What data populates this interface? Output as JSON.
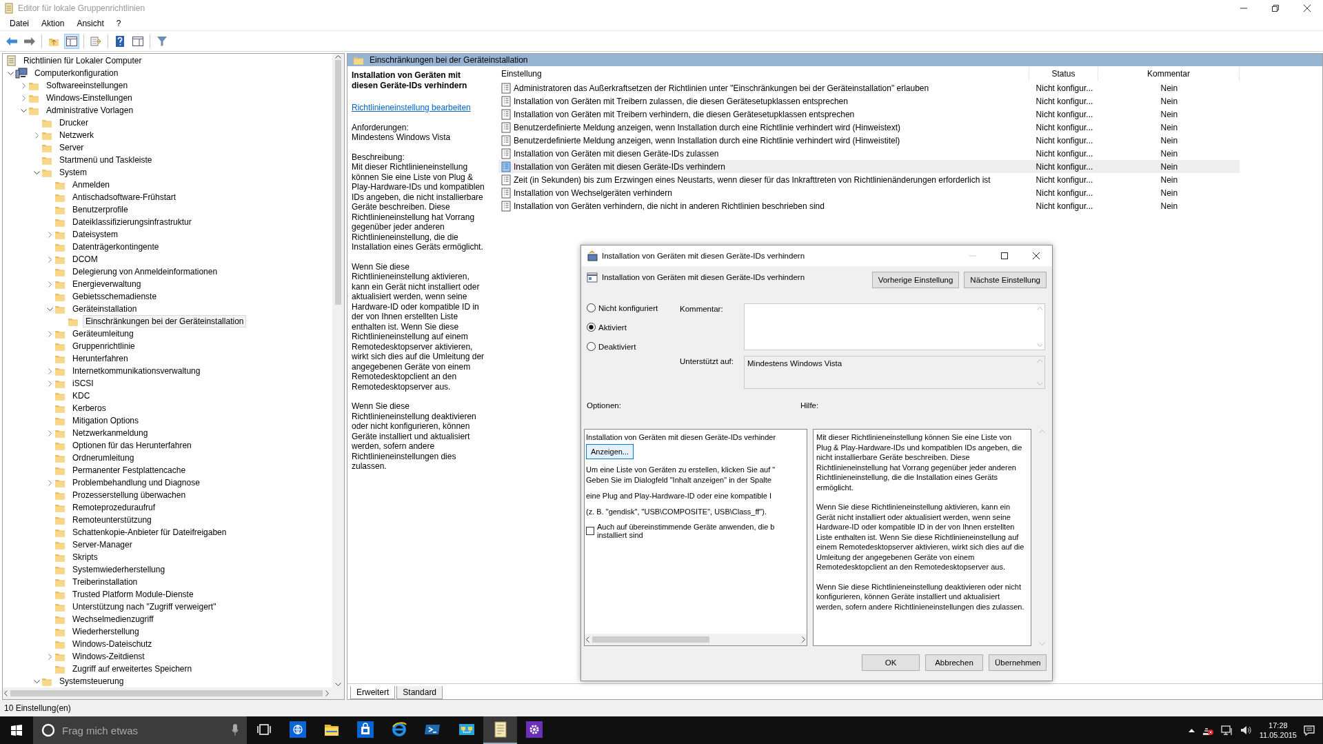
{
  "window": {
    "title": "Editor für lokale Gruppenrichtlinien"
  },
  "menu": [
    "Datei",
    "Aktion",
    "Ansicht",
    "?"
  ],
  "toolbar": {
    "show_tree_pressed": true
  },
  "tree": {
    "items": [
      {
        "label": "Richtlinien für Lokaler Computer",
        "kind": "root",
        "selected": false,
        "children": [
          {
            "label": "Computerkonfiguration",
            "kind": "computer",
            "expanded": true,
            "selected": false,
            "children": [
              {
                "label": "Softwareeinstellungen",
                "kind": "folder",
                "expanded": false,
                "selected": false
              },
              {
                "label": "Windows-Einstellungen",
                "kind": "folder",
                "expanded": false,
                "selected": false
              },
              {
                "label": "Administrative Vorlagen",
                "kind": "folder",
                "expanded": true,
                "selected": false,
                "children": [
                  {
                    "label": "Drucker",
                    "kind": "folder",
                    "selected": false
                  },
                  {
                    "label": "Netzwerk",
                    "kind": "folder",
                    "expanded": false,
                    "selected": false
                  },
                  {
                    "label": "Server",
                    "kind": "folder",
                    "selected": false
                  },
                  {
                    "label": "Startmenü und Taskleiste",
                    "kind": "folder",
                    "selected": false
                  },
                  {
                    "label": "System",
                    "kind": "folder",
                    "expanded": true,
                    "selected": false,
                    "children": [
                      {
                        "label": "Anmelden",
                        "kind": "folder",
                        "selected": false
                      },
                      {
                        "label": "Antischadsoftware-Frühstart",
                        "kind": "folder",
                        "selected": false
                      },
                      {
                        "label": "Benutzerprofile",
                        "kind": "folder",
                        "selected": false
                      },
                      {
                        "label": "Dateiklassifizierungsinfrastruktur",
                        "kind": "folder",
                        "selected": false
                      },
                      {
                        "label": "Dateisystem",
                        "kind": "folder",
                        "expanded": false,
                        "selected": false
                      },
                      {
                        "label": "Datenträgerkontingente",
                        "kind": "folder",
                        "selected": false
                      },
                      {
                        "label": "DCOM",
                        "kind": "folder",
                        "expanded": false,
                        "selected": false
                      },
                      {
                        "label": "Delegierung von Anmeldeinformationen",
                        "kind": "folder",
                        "selected": false
                      },
                      {
                        "label": "Energieverwaltung",
                        "kind": "folder",
                        "expanded": false,
                        "selected": false
                      },
                      {
                        "label": "Gebietsschemadienste",
                        "kind": "folder",
                        "selected": false
                      },
                      {
                        "label": "Geräteinstallation",
                        "kind": "folder",
                        "expanded": true,
                        "selected": false,
                        "children": [
                          {
                            "label": "Einschränkungen bei der Geräteinstallation",
                            "kind": "folder",
                            "selected": true
                          }
                        ]
                      },
                      {
                        "label": "Geräteumleitung",
                        "kind": "folder",
                        "expanded": false,
                        "selected": false
                      },
                      {
                        "label": "Gruppenrichtlinie",
                        "kind": "folder",
                        "selected": false
                      },
                      {
                        "label": "Herunterfahren",
                        "kind": "folder",
                        "selected": false
                      },
                      {
                        "label": "Internetkommunikationsverwaltung",
                        "kind": "folder",
                        "expanded": false,
                        "selected": false
                      },
                      {
                        "label": "iSCSI",
                        "kind": "folder",
                        "expanded": false,
                        "selected": false
                      },
                      {
                        "label": "KDC",
                        "kind": "folder",
                        "selected": false
                      },
                      {
                        "label": "Kerberos",
                        "kind": "folder",
                        "selected": false
                      },
                      {
                        "label": "Mitigation Options",
                        "kind": "folder",
                        "selected": false
                      },
                      {
                        "label": "Netzwerkanmeldung",
                        "kind": "folder",
                        "expanded": false,
                        "selected": false
                      },
                      {
                        "label": "Optionen für das Herunterfahren",
                        "kind": "folder",
                        "selected": false
                      },
                      {
                        "label": "Ordnerumleitung",
                        "kind": "folder",
                        "selected": false
                      },
                      {
                        "label": "Permanenter Festplattencache",
                        "kind": "folder",
                        "selected": false
                      },
                      {
                        "label": "Problembehandlung und Diagnose",
                        "kind": "folder",
                        "expanded": false,
                        "selected": false
                      },
                      {
                        "label": "Prozesserstellung überwachen",
                        "kind": "folder",
                        "selected": false
                      },
                      {
                        "label": "Remoteprozeduraufruf",
                        "kind": "folder",
                        "selected": false
                      },
                      {
                        "label": "Remoteunterstützung",
                        "kind": "folder",
                        "selected": false
                      },
                      {
                        "label": "Schattenkopie-Anbieter für Dateifreigaben",
                        "kind": "folder",
                        "selected": false
                      },
                      {
                        "label": "Server-Manager",
                        "kind": "folder",
                        "selected": false
                      },
                      {
                        "label": "Skripts",
                        "kind": "folder",
                        "selected": false
                      },
                      {
                        "label": "Systemwiederherstellung",
                        "kind": "folder",
                        "selected": false
                      },
                      {
                        "label": "Treiberinstallation",
                        "kind": "folder",
                        "selected": false
                      },
                      {
                        "label": "Trusted Platform Module-Dienste",
                        "kind": "folder",
                        "selected": false
                      },
                      {
                        "label": "Unterstützung nach \"Zugriff verweigert\"",
                        "kind": "folder",
                        "selected": false
                      },
                      {
                        "label": "Wechselmedienzugriff",
                        "kind": "folder",
                        "selected": false
                      },
                      {
                        "label": "Wiederherstellung",
                        "kind": "folder",
                        "selected": false
                      },
                      {
                        "label": "Windows-Dateischutz",
                        "kind": "folder",
                        "selected": false
                      },
                      {
                        "label": "Windows-Zeitdienst",
                        "kind": "folder",
                        "expanded": false,
                        "selected": false
                      },
                      {
                        "label": "Zugriff auf erweitertes Speichern",
                        "kind": "folder",
                        "selected": false
                      }
                    ]
                  },
                  {
                    "label": "Systemsteuerung",
                    "kind": "folder",
                    "expanded": true,
                    "selected": false
                  }
                ]
              }
            ]
          }
        ]
      }
    ]
  },
  "details": {
    "header": "Einschränkungen bei der Geräteinstallation",
    "description": {
      "title": "Installation von Geräten mit diesen Geräte-IDs verhindern",
      "link": "Richtlinieneinstellung bearbeiten",
      "requirements_label": "Anforderungen:",
      "requirements": "Mindestens Windows Vista",
      "description_label": "Beschreibung:",
      "paragraphs": [
        "Mit dieser Richtlinieneinstellung können Sie eine Liste von Plug & Play-Hardware-IDs und kompatiblen IDs angeben, die nicht installierbare Geräte beschreiben. Diese Richtlinieneinstellung hat Vorrang gegenüber jeder anderen Richtlinieneinstellung, die die Installation eines Geräts ermöglicht.",
        "Wenn Sie diese Richtlinieneinstellung aktivieren, kann ein Gerät nicht installiert oder aktualisiert werden, wenn seine Hardware-ID oder kompatible ID in der von Ihnen erstellten Liste enthalten ist. Wenn Sie diese Richtlinieneinstellung auf einem Remotedesktopserver aktivieren, wirkt sich dies auf die Umleitung der angegebenen Geräte von einem Remotedesktopclient an den Remotedesktopserver aus.",
        "Wenn Sie diese Richtlinieneinstellung deaktivieren oder nicht konfigurieren, können Geräte installiert und aktualisiert werden, sofern andere Richtlinieneinstellungen dies zulassen."
      ]
    },
    "table": {
      "columns": [
        "Einstellung",
        "Status",
        "Kommentar"
      ],
      "rows": [
        {
          "setting": "Administratoren das Außerkraftsetzen der Richtlinien unter \"Einschränkungen bei der Geräteinstallation\" erlauben",
          "status": "Nicht konfigur...",
          "comment": "Nein",
          "selected": false
        },
        {
          "setting": "Installation von Geräten mit Treibern zulassen, die diesen Gerätesetupklassen entsprechen",
          "status": "Nicht konfigur...",
          "comment": "Nein",
          "selected": false
        },
        {
          "setting": "Installation von Geräten mit Treibern verhindern, die diesen Gerätesetupklassen entsprechen",
          "status": "Nicht konfigur...",
          "comment": "Nein",
          "selected": false
        },
        {
          "setting": "Benutzerdefinierte Meldung anzeigen, wenn Installation durch eine Richtlinie verhindert wird (Hinweistext)",
          "status": "Nicht konfigur...",
          "comment": "Nein",
          "selected": false
        },
        {
          "setting": "Benutzerdefinierte Meldung anzeigen, wenn Installation durch eine Richtlinie verhindert wird (Hinweistitel)",
          "status": "Nicht konfigur...",
          "comment": "Nein",
          "selected": false
        },
        {
          "setting": "Installation von Geräten mit diesen Geräte-IDs zulassen",
          "status": "Nicht konfigur...",
          "comment": "Nein",
          "selected": false
        },
        {
          "setting": "Installation von Geräten mit diesen Geräte-IDs verhindern",
          "status": "Nicht konfigur...",
          "comment": "Nein",
          "selected": true
        },
        {
          "setting": "Zeit (in Sekunden) bis zum Erzwingen eines Neustarts, wenn dieser für das Inkrafttreten von Richtlinienänderungen  erforderlich ist",
          "status": "Nicht konfigur...",
          "comment": "Nein",
          "selected": false
        },
        {
          "setting": "Installation von Wechselgeräten verhindern",
          "status": "Nicht konfigur...",
          "comment": "Nein",
          "selected": false
        },
        {
          "setting": "Installation von Geräten verhindern, die nicht in anderen Richtlinien beschrieben sind",
          "status": "Nicht konfigur...",
          "comment": "Nein",
          "selected": false
        }
      ]
    },
    "tabs": [
      {
        "label": "Erweitert",
        "selected": true
      },
      {
        "label": "Standard",
        "selected": false
      }
    ]
  },
  "status_bar": "10 Einstellung(en)",
  "dialog": {
    "title": "Installation von Geräten mit diesen Geräte-IDs verhindern",
    "header": "Installation von Geräten mit diesen Geräte-IDs verhindern",
    "nav_buttons": [
      "Vorherige Einstellung",
      "Nächste Einstellung"
    ],
    "states": [
      {
        "label": "Nicht konfiguriert",
        "selected": false
      },
      {
        "label": "Aktiviert",
        "selected": true
      },
      {
        "label": "Deaktiviert",
        "selected": false
      }
    ],
    "comment_label": "Kommentar:",
    "supported_label": "Unterstützt auf:",
    "supported": "Mindestens Windows Vista",
    "options_label": "Optionen:",
    "help_label": "Hilfe:",
    "options": {
      "text": "Installation von Geräten mit diesen Geräte-IDs verhinder",
      "button": "Anzeigen...",
      "notes": [
        [
          "Um eine Liste von Geräten zu erstellen, klicken Sie auf \"",
          "Geben Sie im Dialogfeld \"Inhalt anzeigen\" in der Spalte"
        ],
        [
          "eine Plug and Play-Hardware-ID oder eine kompatible I"
        ],
        [
          "(z. B. \"gendisk\", \"USB\\COMPOSITE\", USB\\Class_ff\")."
        ]
      ],
      "checkbox": {
        "lines": [
          "Auch auf übereinstimmende Geräte anwenden, die b",
          "installiert sind"
        ],
        "checked": false
      }
    },
    "help": [
      "Mit dieser Richtlinieneinstellung können Sie eine Liste von Plug & Play-Hardware-IDs und kompatiblen IDs angeben, die nicht installierbare Geräte beschreiben. Diese Richtlinieneinstellung hat Vorrang gegenüber jeder anderen Richtlinieneinstellung, die die Installation eines Geräts ermöglicht.",
      "Wenn Sie diese Richtlinieneinstellung aktivieren, kann ein Gerät nicht installiert oder aktualisiert werden, wenn seine Hardware-ID oder kompatible ID in der von Ihnen erstellten Liste enthalten ist. Wenn Sie diese Richtlinieneinstellung auf einem Remotedesktopserver aktivieren, wirkt sich dies auf die Umleitung der angegebenen Geräte von einem Remotedesktopclient an den Remotedesktopserver aus.",
      "Wenn Sie diese Richtlinieneinstellung deaktivieren oder nicht konfigurieren, können Geräte installiert und aktualisiert werden, sofern andere Richtlinieneinstellungen dies zulassen."
    ],
    "buttons": [
      "OK",
      "Abbrechen",
      "Übernehmen"
    ]
  },
  "taskbar": {
    "search_placeholder": "Frag mich etwas",
    "apps": [
      {
        "kind": "globe",
        "active": false
      },
      {
        "kind": "folder",
        "active": false
      },
      {
        "kind": "store",
        "active": false
      },
      {
        "kind": "browser",
        "active": false
      },
      {
        "kind": "shell",
        "active": false
      },
      {
        "kind": "network",
        "active": false
      },
      {
        "kind": "editor",
        "active": true
      },
      {
        "kind": "gear",
        "active": false
      }
    ],
    "time": "17:28",
    "date": "11.05.2015"
  }
}
